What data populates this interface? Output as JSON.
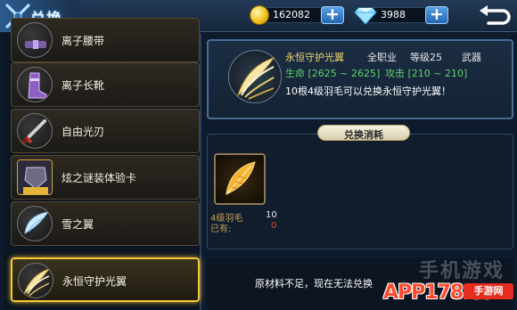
{
  "header": {
    "title": "兑换",
    "gold": "162082",
    "diamond": "3988",
    "plus_label": "+"
  },
  "icons": {
    "title": "crossed-swords-icon",
    "gold": "gold-coin-icon",
    "diamond": "diamond-icon",
    "back": "return-arrow-icon"
  },
  "list": {
    "items": [
      {
        "label": "离子腰带",
        "icon": "belt-icon"
      },
      {
        "label": "离子长靴",
        "icon": "boots-icon"
      },
      {
        "label": "自由光刃",
        "icon": "light-blade-icon"
      },
      {
        "label": "炫之谜装体验卡",
        "icon": "armor-card-icon"
      },
      {
        "label": "雪之翼",
        "icon": "snow-wing-icon"
      },
      {
        "label": "永恒守护光翼",
        "icon": "eternal-wing-icon"
      }
    ]
  },
  "detail": {
    "name": "永恒守护光翼",
    "job": "全职业",
    "level": "等级25",
    "type": "武器",
    "hp": "生命 [2625 ~ 2625]",
    "attack": "攻击 [210 ~ 210]",
    "description": "10根4级羽毛可以兑换永恒守护光翼！"
  },
  "cost": {
    "tab_label": "兑换消耗",
    "material_name": "4级羽毛",
    "material_need": "10",
    "have_label": "已有:",
    "have_value": "0"
  },
  "status": {
    "message": "原材料不足，现在无法兑换"
  },
  "watermark": {
    "cn": "手机游戏",
    "site": "APP178.com",
    "sub": "手游网"
  },
  "colors": {
    "selected_border": "#f3c93b",
    "stat_green": "#5fd36a",
    "name_gold": "#f1d66a",
    "have_red": "#d34a3a"
  }
}
